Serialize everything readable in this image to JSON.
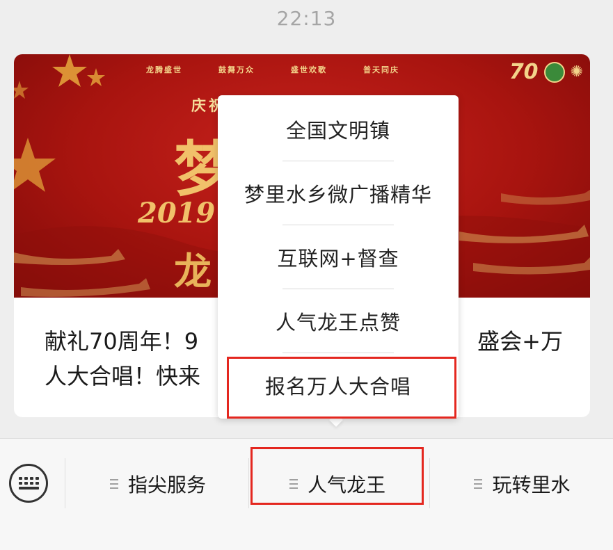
{
  "status_bar": {
    "time": "22:13"
  },
  "banner": {
    "slogans": [
      "龙腾盛世",
      "鼓舞万众",
      "盛世欢歌",
      "普天同庆"
    ],
    "subtitle": "庆祝",
    "big_char": "梦",
    "year_text": "2019",
    "char2": "龙",
    "badge_70": "70"
  },
  "article": {
    "title_line1": "献礼70周年！9",
    "title_line1_end": "盛会+万",
    "title_line2": "人大合唱！快来"
  },
  "popup_menu": {
    "items": [
      {
        "label": "全国文明镇"
      },
      {
        "label": "梦里水乡微广播精华"
      },
      {
        "label": "互联网+督查"
      },
      {
        "label": "人气龙王点赞"
      },
      {
        "label": "报名万人大合唱"
      }
    ]
  },
  "bottom_menu": {
    "tabs": [
      {
        "label": "指尖服务"
      },
      {
        "label": "人气龙王"
      },
      {
        "label": "玩转里水"
      }
    ]
  },
  "colors": {
    "highlight": "#e4271f",
    "banner_red": "#b3171a",
    "gold": "#f1c16a"
  }
}
